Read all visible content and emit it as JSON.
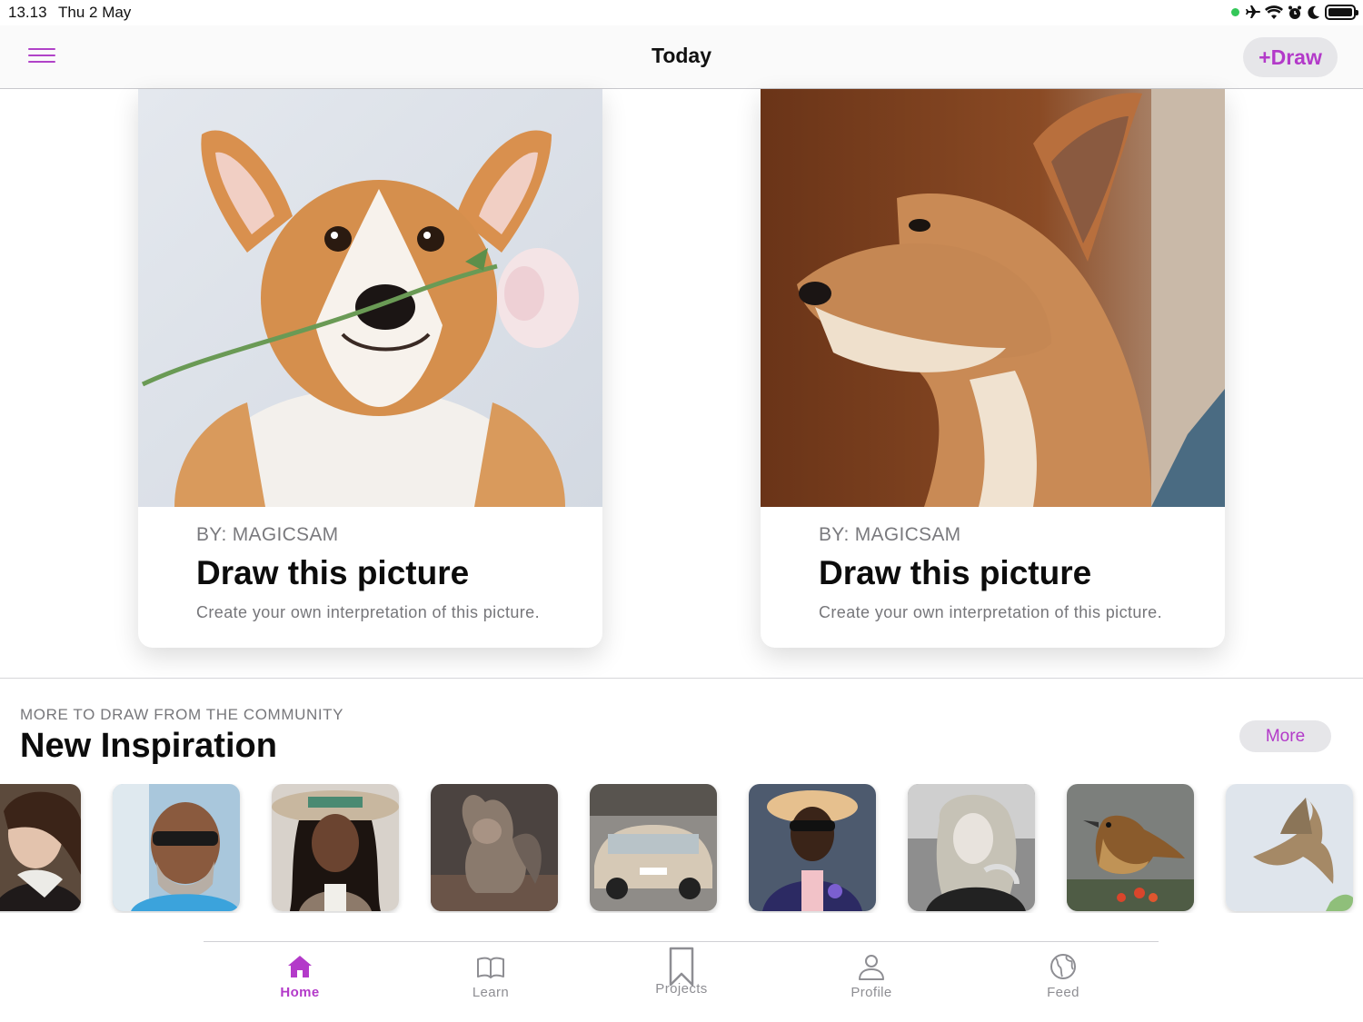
{
  "status_bar": {
    "time": "13.13",
    "date": "Thu 2 May"
  },
  "nav": {
    "title": "Today",
    "draw_button": "+Draw"
  },
  "featured": [
    {
      "author": "BY: MAGICSAM",
      "title": "Draw this picture",
      "description": "Create your own interpretation of this picture."
    },
    {
      "author": "BY: MAGICSAM",
      "title": "Draw this picture",
      "description": "Create your own interpretation of this picture."
    }
  ],
  "community": {
    "label": "MORE TO DRAW FROM THE COMMUNITY",
    "title": "New Inspiration",
    "more_button": "More"
  },
  "tabs": [
    {
      "label": "Home",
      "icon": "house-icon",
      "active": true
    },
    {
      "label": "Learn",
      "icon": "book-icon",
      "active": false
    },
    {
      "label": "Projects",
      "icon": "bookmark-icon",
      "active": false
    },
    {
      "label": "Profile",
      "icon": "person-icon",
      "active": false
    },
    {
      "label": "Feed",
      "icon": "globe-icon",
      "active": false
    }
  ],
  "colors": {
    "accent": "#b33ac9",
    "inactive_tab": "#8e8e93",
    "button_bg": "#e6e6e9"
  }
}
